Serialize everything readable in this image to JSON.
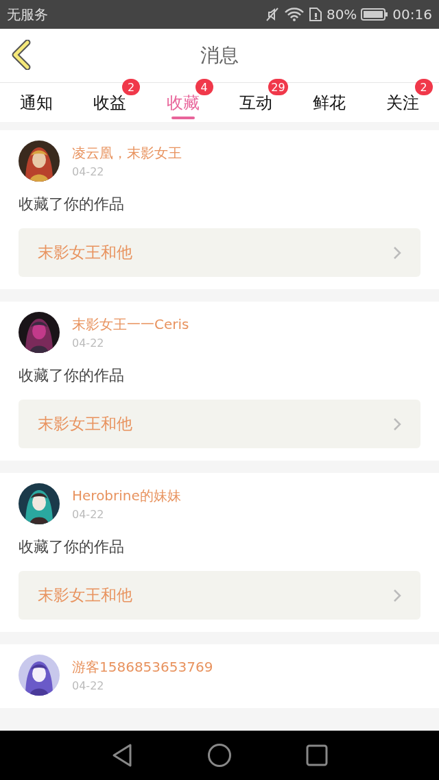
{
  "status_bar": {
    "carrier": "无服务",
    "battery": "80%",
    "time": "00:16"
  },
  "header": {
    "title": "消息"
  },
  "tabs": [
    {
      "label": "通知",
      "selected": false
    },
    {
      "label": "收益",
      "selected": false,
      "badge": "2"
    },
    {
      "label": "收藏",
      "selected": true,
      "badge": "4"
    },
    {
      "label": "互动",
      "selected": false,
      "badge": "29"
    },
    {
      "label": "鲜花",
      "selected": false
    },
    {
      "label": "关注",
      "selected": false,
      "badge": "2"
    }
  ],
  "messages": [
    {
      "user": "凌云凰，末影女王",
      "date": "04-22",
      "action": "收藏了你的作品",
      "work": "末影女王和他"
    },
    {
      "user": "末影女王一一Ceris",
      "date": "04-22",
      "action": "收藏了你的作品",
      "work": "末影女王和他"
    },
    {
      "user": "Herobrine的妹妹",
      "date": "04-22",
      "action": "收藏了你的作品",
      "work": "末影女王和他"
    },
    {
      "user": "游客1586853653769",
      "date": "04-22"
    }
  ]
}
